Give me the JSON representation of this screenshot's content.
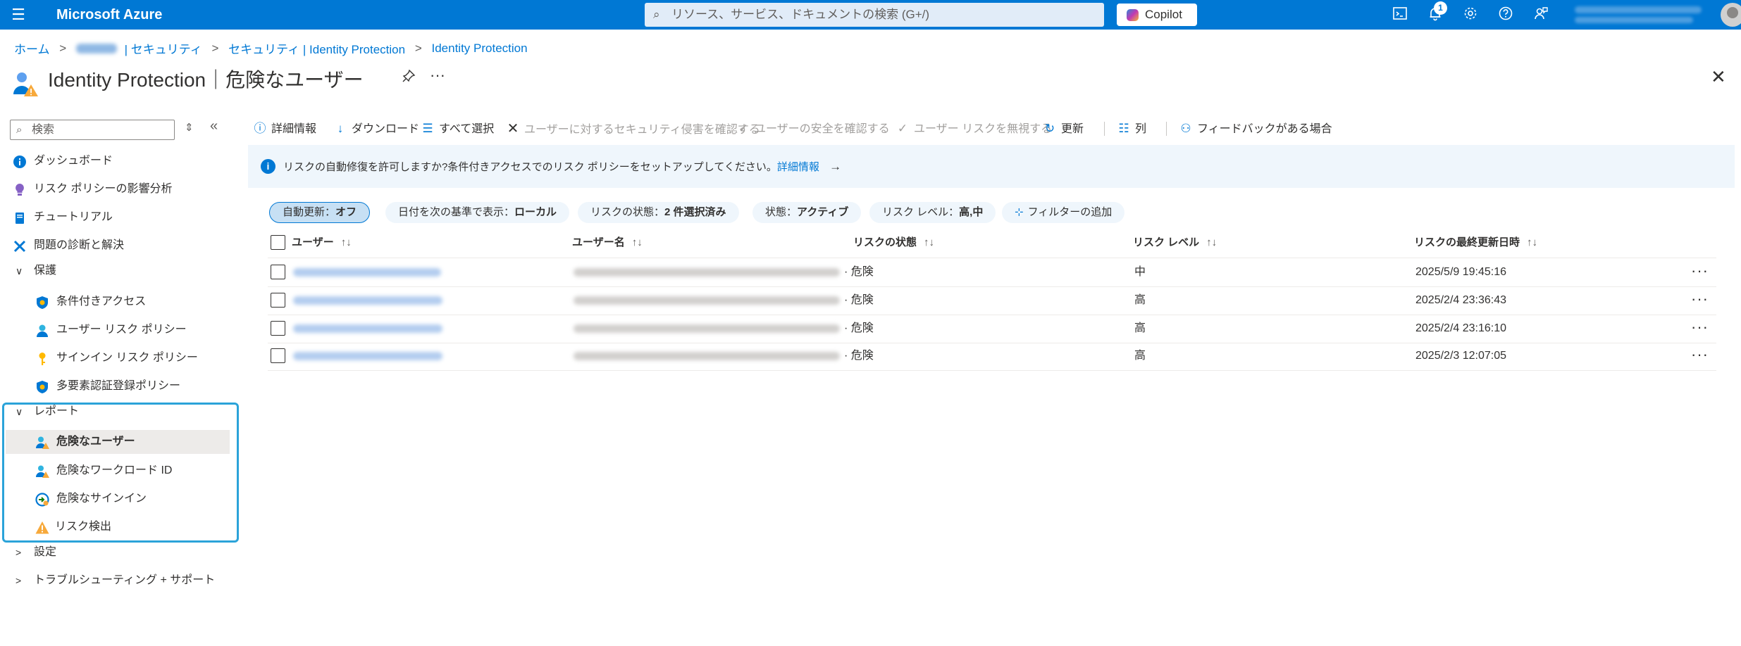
{
  "topbar": {
    "brand": "Microsoft Azure",
    "search_placeholder": "リソース、サービス、ドキュメントの検索 (G+/)",
    "copilot_label": "Copilot",
    "notifications_count": "1"
  },
  "breadcrumb": {
    "home": "ホーム",
    "tenant_suffix": "| セキュリティ",
    "security_ip": "セキュリティ | Identity Protection",
    "ip": "Identity Protection"
  },
  "page": {
    "title": "Identity Protection｜危険なユーザー"
  },
  "sidebar": {
    "search_placeholder": "検索",
    "items": {
      "dashboard": "ダッシュボード",
      "risk_policy_impact": "リスク ポリシーの影響分析",
      "tutorial": "チュートリアル",
      "diagnose": "問題の診断と解決",
      "protection": "保護",
      "conditional_access": "条件付きアクセス",
      "user_risk_policy": "ユーザー リスク ポリシー",
      "signin_risk_policy": "サインイン リスク ポリシー",
      "mfa_registration": "多要素認証登録ポリシー",
      "reports": "レポート",
      "risky_users": "危険なユーザー",
      "risky_workload": "危険なワークロード ID",
      "risky_signins": "危険なサインイン",
      "risk_detections": "リスク検出",
      "settings": "設定",
      "troubleshoot": "トラブルシューティング + サポート"
    }
  },
  "toolbar": {
    "details": "詳細情報",
    "download": "ダウンロード",
    "select_all": "すべて選択",
    "confirm_compromised": "ユーザーに対するセキュリティ侵害を確認する",
    "confirm_safe": "ユーザーの安全を確認する",
    "dismiss_risk": "ユーザー リスクを無視する",
    "refresh": "更新",
    "columns": "列",
    "feedback": "フィードバックがある場合"
  },
  "infobar": {
    "text": "リスクの自動修復を許可しますか?条件付きアクセスでのリスク ポリシーをセットアップしてください。",
    "link": "詳細情報",
    "arrow": "→"
  },
  "filters": {
    "auto_refresh_label": "自動更新：",
    "auto_refresh_value": "オフ",
    "date_label": "日付を次の基準で表示：",
    "date_value": "ローカル",
    "risk_state_label": "リスクの状態：",
    "risk_state_value": "2 件選択済み",
    "status_label": "状態：",
    "status_value": "アクティブ",
    "risk_level_label": "リスク レベル：",
    "risk_level_value": "高,中",
    "add_filter": "フィルターの追加"
  },
  "table": {
    "columns": [
      "ユーザー",
      "ユーザー名",
      "リスクの状態",
      "リスク レベル",
      "リスクの最終更新日時"
    ],
    "sort_glyph": "↑↓",
    "rows": [
      {
        "risk_state": "危険",
        "risk_level": "中",
        "updated": "2025/5/9 19:45:16"
      },
      {
        "risk_state": "危険",
        "risk_level": "高",
        "updated": "2025/2/4 23:36:43"
      },
      {
        "risk_state": "危険",
        "risk_level": "高",
        "updated": "2025/2/4 23:16:10"
      },
      {
        "risk_state": "危険",
        "risk_level": "高",
        "updated": "2025/2/3 12:07:05"
      }
    ]
  }
}
